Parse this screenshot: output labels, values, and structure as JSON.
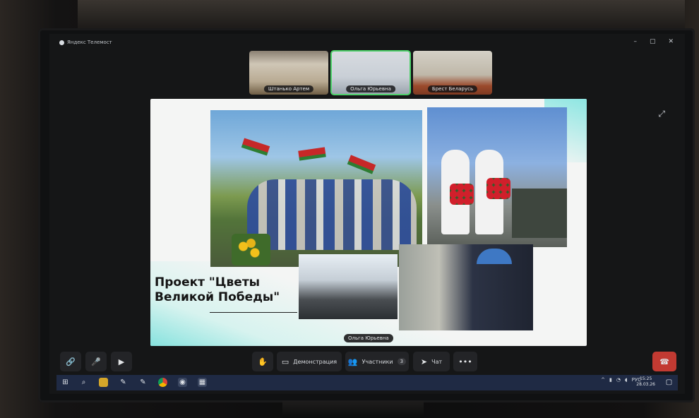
{
  "app": {
    "title": "Яндекс Телемост"
  },
  "window_controls": [
    "–",
    "▢",
    "✕"
  ],
  "participants": [
    {
      "name": "Штанько Артем",
      "active": false
    },
    {
      "name": "Ольга Юрьевна",
      "active": true
    },
    {
      "name": "Брест Беларусь",
      "active": false
    }
  ],
  "slide": {
    "title_line1": "Проект \"Цветы",
    "title_line2": "Великой Победы\""
  },
  "speaker_label": "Ольга Юрьевна",
  "toolbar": {
    "demo_label": "Демонстрация",
    "participants_label": "Участники",
    "participants_count": "3",
    "chat_label": "Чат"
  },
  "taskbar": {
    "lang": "РУС",
    "time": "15:25",
    "date": "28.03.26"
  },
  "colors": {
    "active_outline": "#4ed16a",
    "leave_button": "#c23a32",
    "taskbar": "#1f2a44"
  }
}
